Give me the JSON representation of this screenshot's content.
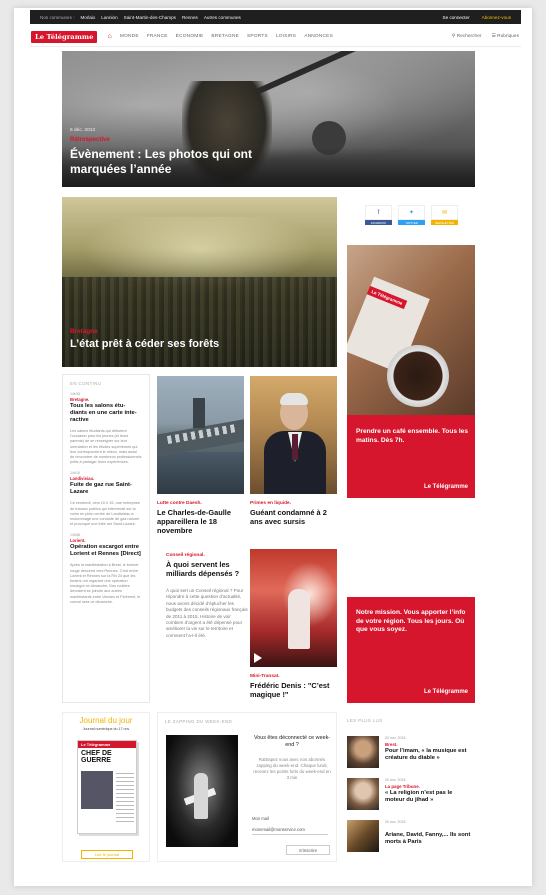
{
  "topbar": {
    "label": "Nos communes :",
    "cities": [
      "Morlaix",
      "Lannion",
      "Saint-Martin-des-Champs",
      "Rennes",
      "Autres communes"
    ],
    "login": "Se connecter",
    "subscribe": "Abonnez-vous"
  },
  "header": {
    "logo": "Le Télégramme",
    "home_icon": "home-icon",
    "nav": [
      "MONDE",
      "FRANCE",
      "ÉCONOMIE",
      "BRETAGNE",
      "SPORTS",
      "LOISIRS",
      "ANNONCES"
    ],
    "search": "Rechercher",
    "rubriques": "Rubriques"
  },
  "hero": {
    "date": "6 déc. 2013",
    "category": "Rétrospective",
    "title": "Évènement : Les photos qui ont marquées l’année"
  },
  "forest": {
    "category": "Bretagne",
    "title": "L’état prêt à céder ses forêts"
  },
  "share": {
    "facebook": "Facebook",
    "twitter": "Twitter",
    "mail": "Newsletter"
  },
  "ad1": {
    "paper_logo": "Le Télégramme",
    "text": "Prendre un café ensemble. Tous les matins. Dès 7h.",
    "brand": "Le Télégramme"
  },
  "ad2": {
    "text": "Notre mission. Vous apporter l’info de votre région. Tous les jours. Où que vous soyez.",
    "brand": "Le Télégramme"
  },
  "continu": {
    "heading": "En continu",
    "items": [
      {
        "time": "14h35",
        "category": "Bretagne.",
        "title": "Tous les salons étu-diants en une carte inte-ractive",
        "body": "Les salons étudiants qui débutent l’occasion pour les jeunes (et leurs parents) de se renseigner sur leur orientation et les études supérieures qui leur correspondent le mieux, mais aussi de rencontrer de nombreux professionnels prêts à partager leurs expériences."
      },
      {
        "time": "14h10",
        "category": "Landivisiau.",
        "title": "Fuite de gaz rue Saint-Lazare",
        "body": "Ce vendredi, vers 10 h 15, une entreprise de travaux publics qui intervenait sur la voirie en plein centre de Landivisiau a endommagé une conduite de gaz naturel et provoqué une fuite rue Saint-Lazare."
      },
      {
        "time": "13h58",
        "category": "Lorient.",
        "title": "Opération escargot entre Lorient et Rennes [Direct]",
        "body": "Après la manifestation à Brest, le bonnet rouge descend vers Rennes. C’est entre Lorient et Rennes sur la RN 24 que les forains ont organisé une opération escargot ce dimanche. Des routiers devraient se joindre aux autres manifestants entre Vannes et Ploërmel, le convoi sera ce dimanche."
      }
    ]
  },
  "cards": {
    "ship": {
      "category": "Lutte contre Daesh.",
      "title": "Le Charles-de-Gaulle appareillera le 18 novembre"
    },
    "man": {
      "category": "Primes en liquide.",
      "title": "Guéant condamné à 2 ans avec sursis"
    },
    "concert": {
      "category": "Mini-Transat.",
      "title": "Frédéric Denis : \"C’est magique !\""
    }
  },
  "conseil": {
    "category": "Conseil régional.",
    "title": "À quoi servent les milliards dépensés ?",
    "body": "À quoi sert un Conseil régional ? Pour répondre à cette question d’actualité, nous avons décidé d’éplucher les budgets des conseils régionaux français de 2011 à 2015. Histoire de voir combien d’argent a été dépensé pour améliorer la vie sur le territoire et comment l’a-t-il été."
  },
  "journal": {
    "title": "Journal du jour",
    "subtitle": "Journal numérique du 17 nov",
    "cover_brand": "Le Télégramme",
    "cover_head": "CHEF DE GUERRE",
    "button": "Lire le journal"
  },
  "zapping": {
    "heading": "Le zapping du week-end",
    "question": "Vous êtes déconnecté ce week-end ?",
    "description": "Rattrapez vous avec nos abonnés zapping du week-end. Chaque lundi, recevez les points forts du week-end en 3 min",
    "email_label": "Mon mail",
    "email_value": "monemail@monservice.com",
    "submit": "S’inscrire"
  },
  "populaire": {
    "heading": "Les plus lus",
    "items": [
      {
        "time": "20 nov. 2015",
        "category": "Brest.",
        "title": "Pour l’imam, « la musique est créature du diable »"
      },
      {
        "time": "20 nov. 2015",
        "category": "La page Tribune.",
        "title": "« La religion n’est pas le moteur du jihad »"
      },
      {
        "time": "20 nov. 2015",
        "category": "",
        "title": "Ariane, David, Fanny,... Ils sont morts à Paris"
      }
    ]
  }
}
